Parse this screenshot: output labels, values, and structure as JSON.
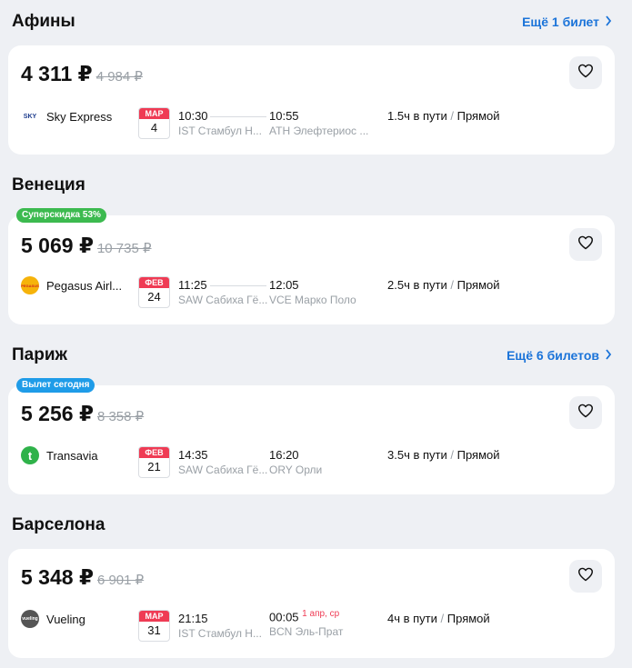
{
  "sections": [
    {
      "title": "Афины",
      "more": "Ещё 1 билет",
      "badge": "",
      "price": "4 311 ₽",
      "old_price": "4 984 ₽",
      "airline": "Sky Express",
      "month": "МАР",
      "day": "4",
      "dep_time": "10:30",
      "dep_place": "IST Стамбул Н...",
      "arr_time": "10:55",
      "arr_place": "ATH Элефтериос ...",
      "next_day": "",
      "duration": "1.5ч в пути",
      "sep": "/",
      "type": "Прямой"
    },
    {
      "title": "Венеция",
      "more": "",
      "badge": "Суперскидка 53%",
      "price": "5 069 ₽",
      "old_price": "10 735 ₽",
      "airline": "Pegasus Airl...",
      "month": "ФЕВ",
      "day": "24",
      "dep_time": "11:25",
      "dep_place": "SAW Сабиха Гё...",
      "arr_time": "12:05",
      "arr_place": "VCE Марко Поло",
      "next_day": "",
      "duration": "2.5ч в пути",
      "sep": "/",
      "type": "Прямой"
    },
    {
      "title": "Париж",
      "more": "Ещё 6 билетов",
      "badge": "Вылет сегодня",
      "price": "5 256 ₽",
      "old_price": "8 358 ₽",
      "airline": "Transavia",
      "month": "ФЕВ",
      "day": "21",
      "dep_time": "14:35",
      "dep_place": "SAW Сабиха Гё...",
      "arr_time": "16:20",
      "arr_place": "ORY Орли",
      "next_day": "",
      "duration": "3.5ч в пути",
      "sep": "/",
      "type": "Прямой"
    },
    {
      "title": "Барселона",
      "more": "",
      "badge": "",
      "price": "5 348 ₽",
      "old_price": "6 901 ₽",
      "airline": "Vueling",
      "month": "МАР",
      "day": "31",
      "dep_time": "21:15",
      "dep_place": "IST Стамбул Н...",
      "arr_time": "00:05",
      "arr_place": "BCN Эль-Прат",
      "next_day": "1 апр, ср",
      "duration": "4ч в пути",
      "sep": "/",
      "type": "Прямой"
    }
  ],
  "icons": {
    "favorite": "heart-outline-icon",
    "chevron": "chevron-right-icon"
  },
  "colors": {
    "accent_link": "#1a73d9",
    "calendar_red": "#ef3b54",
    "badge_green": "#3cba4f",
    "badge_blue": "#1f9ce8",
    "muted": "#9aa0a6"
  },
  "logos": {
    "sky": "SKY",
    "pegasus": "PEGASUS",
    "transavia": "t",
    "vueling": "vueling"
  }
}
